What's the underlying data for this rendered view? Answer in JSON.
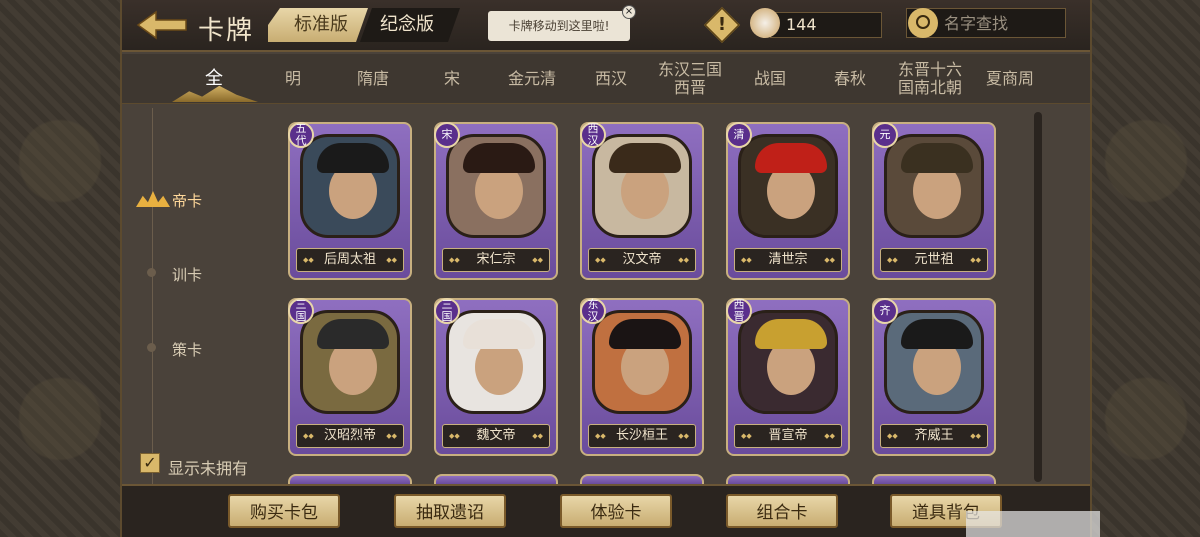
{
  "header": {
    "title": "卡牌",
    "version_tabs": [
      {
        "label": "标准版",
        "active": true
      },
      {
        "label": "纪念版",
        "active": false
      }
    ],
    "tooltip": "卡牌移动到这里啦!",
    "tooltip_close": "×",
    "warning_mark": "!",
    "currency_value": "144",
    "search_placeholder": "名字查找"
  },
  "dynasty_tabs": [
    {
      "label": "全",
      "active": true
    },
    {
      "label": "明"
    },
    {
      "label": "隋唐"
    },
    {
      "label": "宋"
    },
    {
      "label": "金元清"
    },
    {
      "label": "西汉"
    },
    {
      "label": "东汉三国西晋"
    },
    {
      "label": "战国"
    },
    {
      "label": "春秋"
    },
    {
      "label": "东晋十六国南北朝"
    },
    {
      "label": "夏商周"
    }
  ],
  "side_menu": {
    "items": [
      {
        "label": "帝卡",
        "active": true
      },
      {
        "label": "训卡"
      },
      {
        "label": "策卡"
      }
    ],
    "show_unowned_label": "显示未拥有",
    "show_unowned_checked": true,
    "check_mark": "✓"
  },
  "cards": [
    {
      "name": "后周太祖",
      "badge": "五代",
      "hat_color": "#1a1a1a",
      "bg": "#3a4a5a"
    },
    {
      "name": "宋仁宗",
      "badge": "宋",
      "hat_color": "#2a1a14",
      "bg": "#8a7060"
    },
    {
      "name": "汉文帝",
      "badge": "西汉",
      "hat_color": "#3a2a1a",
      "bg": "#c8b8a0"
    },
    {
      "name": "清世宗",
      "badge": "清",
      "hat_color": "#c02018",
      "bg": "#3a3024"
    },
    {
      "name": "元世祖",
      "badge": "元",
      "hat_color": "#3a3020",
      "bg": "#5a4a3a"
    },
    {
      "name": "汉昭烈帝",
      "badge": "三国",
      "hat_color": "#2a2a2a",
      "bg": "#7a6a40"
    },
    {
      "name": "魏文帝",
      "badge": "三国",
      "hat_color": "#e8e0d8",
      "bg": "#e8e4e0"
    },
    {
      "name": "长沙桓王",
      "badge": "东汉",
      "hat_color": "#1a1414",
      "bg": "#c07040"
    },
    {
      "name": "晋宣帝",
      "badge": "西晋",
      "hat_color": "#c8a030",
      "bg": "#3a2a30"
    },
    {
      "name": "齐威王",
      "badge": "齐",
      "hat_color": "#1a1a1a",
      "bg": "#5a6a7a"
    }
  ],
  "bottom_buttons": [
    "购买卡包",
    "抽取遗诏",
    "体验卡",
    "组合卡",
    "道具背包"
  ]
}
